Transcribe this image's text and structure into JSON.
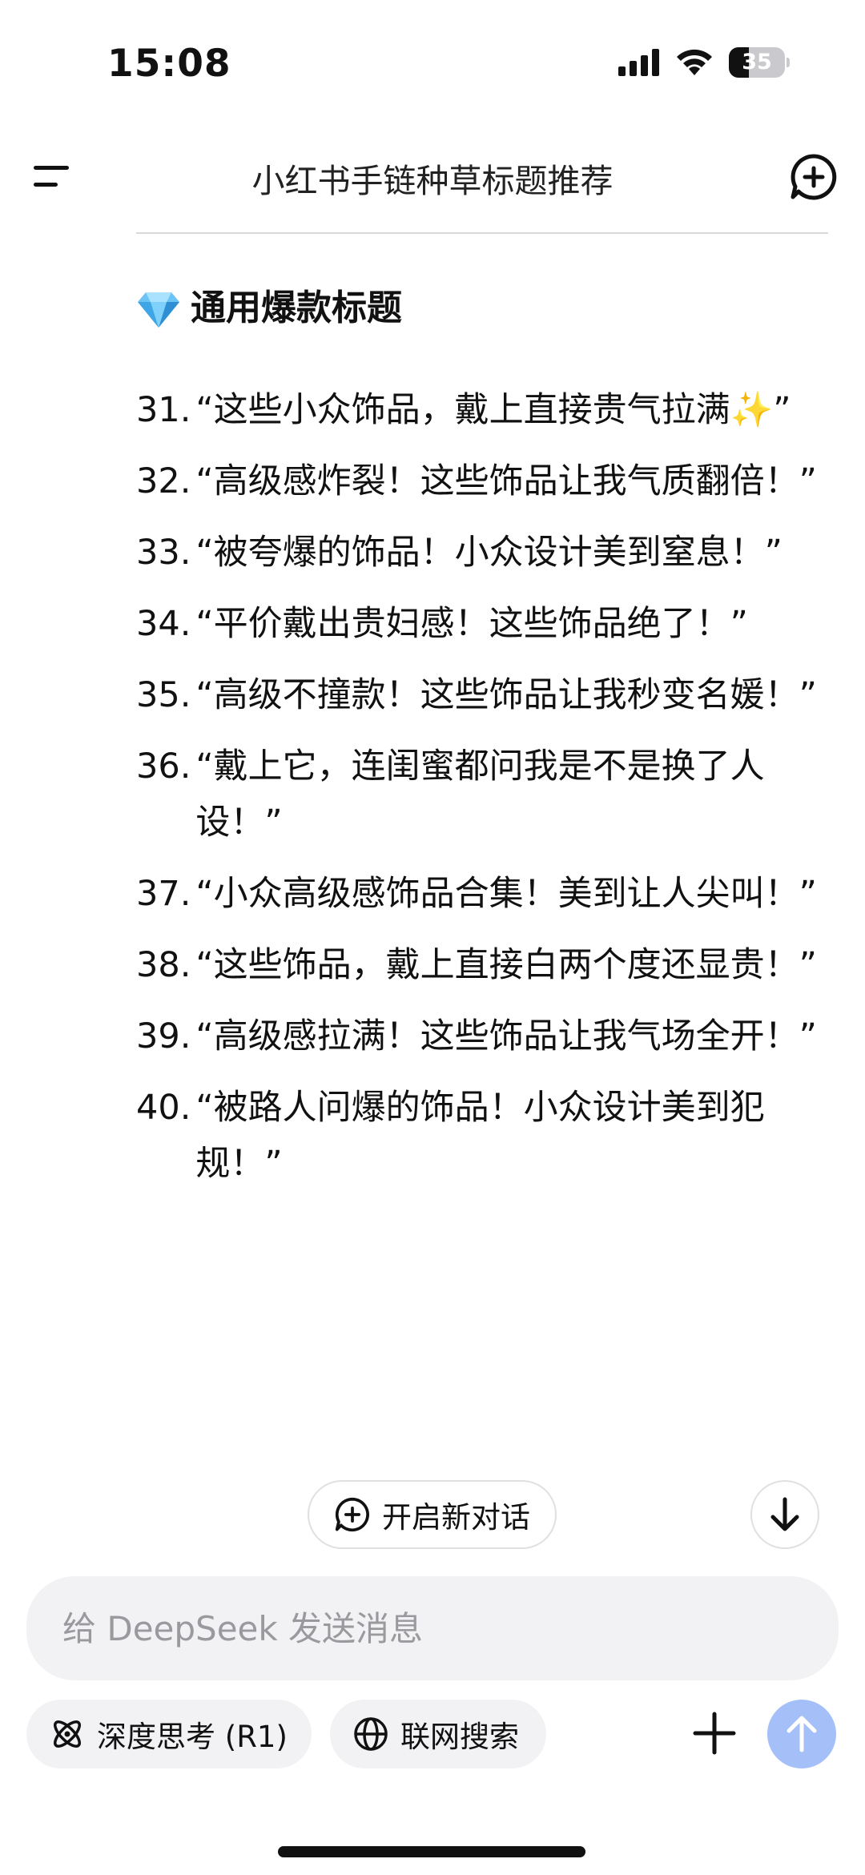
{
  "status_bar": {
    "time": "15:08",
    "battery_level": "35",
    "battery_fraction": 0.35
  },
  "header": {
    "title": "小红书手链种草标题推荐",
    "menu_icon": "menu-icon",
    "new_chat_icon": "new-chat-plus-icon"
  },
  "content": {
    "section_heading": {
      "icon": "gem-icon",
      "text": "通用爆款标题"
    },
    "items": [
      {
        "num": "31.",
        "text": "“这些小众饰品，戴上直接贵气拉满✨”"
      },
      {
        "num": "32.",
        "text": "“高级感炸裂！这些饰品让我气质翻倍！”"
      },
      {
        "num": "33.",
        "text": "“被夸爆的饰品！小众设计美到窒息！”"
      },
      {
        "num": "34.",
        "text": "“平价戴出贵妇感！这些饰品绝了！”"
      },
      {
        "num": "35.",
        "text": "“高级不撞款！这些饰品让我秒变名媛！”"
      },
      {
        "num": "36.",
        "text": "“戴上它，连闺蜜都问我是不是换了人设！”"
      },
      {
        "num": "37.",
        "text": "“小众高级感饰品合集！美到让人尖叫！”"
      },
      {
        "num": "38.",
        "text": "“这些饰品，戴上直接白两个度还显贵！”"
      },
      {
        "num": "39.",
        "text": "“高级感拉满！这些饰品让我气场全开！”"
      },
      {
        "num": "40.",
        "text": "“被路人问爆的饰品！小众设计美到犯规！”"
      }
    ]
  },
  "floating": {
    "new_chat_label": "开启新对话",
    "scroll_down_icon": "arrow-down-icon"
  },
  "composer": {
    "placeholder": "给 DeepSeek 发送消息",
    "deep_think_label": "深度思考 (R1)",
    "web_search_label": "联网搜索",
    "plus_icon": "plus-icon",
    "send_icon": "arrow-up-icon",
    "send_color": "#a5bff8"
  }
}
